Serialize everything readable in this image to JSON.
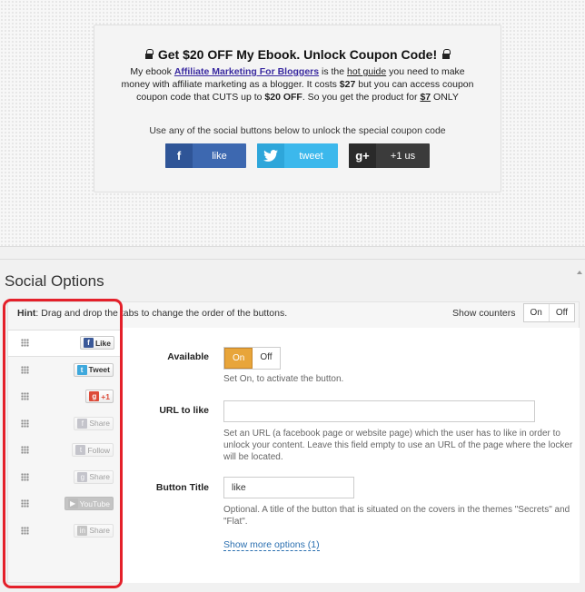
{
  "locker": {
    "title": "Get $20 OFF My Ebook. Unlock Coupon Code!",
    "text_1": "My ebook ",
    "link": "Affiliate Marketing For Bloggers",
    "text_2": " is the ",
    "hot_guide": "hot guide",
    "text_3": " you need to make money with affiliate marketing as a blogger. It costs ",
    "price": "$27",
    "text_4": " but you can access coupon coupon code that CUTS up to ",
    "discount": "$20 OFF",
    "text_5": ". So you get the product for ",
    "final_price": "$7",
    "text_6": " ONLY",
    "hint": "Use any of the social buttons below to unlock the special coupon code",
    "buttons": [
      {
        "icon": "f",
        "label": "like"
      },
      {
        "icon": "t",
        "label": "tweet"
      },
      {
        "icon": "g+",
        "label": "+1 us"
      }
    ]
  },
  "options": {
    "title": "Social Options",
    "hint_bold": "Hint",
    "hint_text": ": Drag and drop the tabs to change the order of the buttons.",
    "counters_label": "Show counters",
    "counters_on": "On",
    "counters_off": "Off",
    "tabs": [
      {
        "icon": "f",
        "label": "Like",
        "color": "#3b5998"
      },
      {
        "icon": "t",
        "label": "Tweet",
        "color": "#3ea8dc"
      },
      {
        "icon": "g",
        "label": "+1",
        "color": "#dd4b39"
      },
      {
        "icon": "f",
        "label": "Share",
        "color": "#9aa"
      },
      {
        "icon": "t",
        "label": "Follow",
        "color": "#9aa"
      },
      {
        "icon": "g",
        "label": "Share",
        "color": "#9aa"
      },
      {
        "icon": "▶",
        "label": "YouTube",
        "color": "#999"
      },
      {
        "icon": "in",
        "label": "Share",
        "color": "#999"
      }
    ],
    "available_label": "Available",
    "available_on": "On",
    "available_off": "Off",
    "available_help": "Set On, to activate the button.",
    "url_label": "URL to like",
    "url_value": "",
    "url_help": "Set an URL (a facebook page or website page) which the user has to like in order to unlock your content. Leave this field empty to use an URL of the page where the locker will be located.",
    "button_title_label": "Button Title",
    "button_title_value": "like",
    "button_title_help": "Optional. A title of the button that is situated on the covers in the themes \"Secrets\" and \"Flat\".",
    "more_options": "Show more options (1)"
  }
}
